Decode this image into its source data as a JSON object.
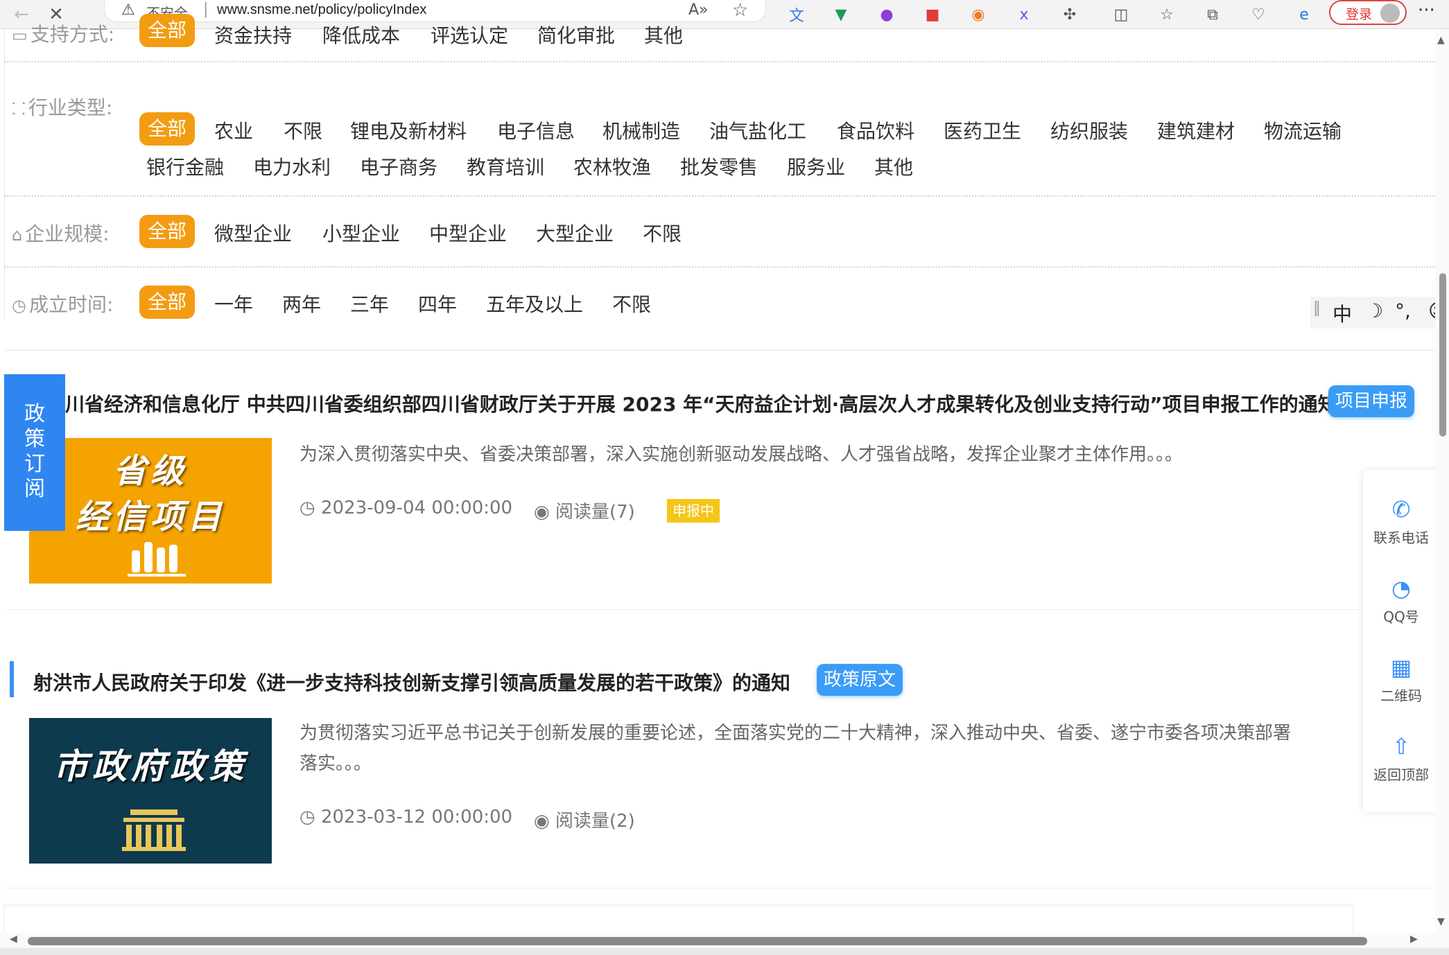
{
  "browser": {
    "back_icon": "back-arrow-icon",
    "close_icon": "close-icon",
    "security_label": "不安全",
    "separator": "|",
    "url": "www.snsme.net/policy/policyIndex",
    "login_label": "登录"
  },
  "filters": {
    "support": {
      "label": "支持方式:",
      "options": [
        "全部",
        "资金扶持",
        "降低成本",
        "评选认定",
        "简化审批",
        "其他"
      ]
    },
    "industry": {
      "label": "行业类型:",
      "options": [
        "全部",
        "农业",
        "不限",
        "锂电及新材料",
        "电子信息",
        "机械制造",
        "油气盐化工",
        "食品饮料",
        "医药卫生",
        "纺织服装",
        "建筑建材",
        "物流运输",
        "银行金融",
        "电力水利",
        "电子商务",
        "教育培训",
        "农林牧渔",
        "批发零售",
        "服务业",
        "其他"
      ]
    },
    "scale": {
      "label": "企业规模:",
      "options": [
        "全部",
        "微型企业",
        "小型企业",
        "中型企业",
        "大型企业",
        "不限"
      ]
    },
    "founded": {
      "label": "成立时间:",
      "options": [
        "全部",
        "一年",
        "两年",
        "三年",
        "四年",
        "五年及以上",
        "不限"
      ]
    }
  },
  "ime": {
    "mode": "中",
    "moon": "☽",
    "punct": "°,",
    "emoji": "☺"
  },
  "subscribe_tab": {
    "label": [
      "政",
      "策",
      "订",
      "阅"
    ]
  },
  "policies": [
    {
      "title": "川省经济和信息化厅 中共四川省委组织部四川省财政厅关于开展 2023 年“天府益企计划·高层次人才成果转化及创业支持行动”项目申报工作的通知",
      "tag": "项目申报",
      "thumb_text": [
        "省级",
        "经信项目"
      ],
      "thumb_color": "#f5a300",
      "description": "为深入贯彻落实中央、省委决策部署，深入实施创新驱动发展战略、人才强省战略，发挥企业聚才主体作用。。。",
      "date": "2023-09-04 00:00:00",
      "views": "阅读量(7)",
      "status": "申报中"
    },
    {
      "title": "射洪市人民政府关于印发《进一步支持科技创新支撑引领高质量发展的若干政策》的通知",
      "tag": "政策原文",
      "thumb_text": [
        "市政府政策"
      ],
      "thumb_color": "#0e3a4e",
      "description_line1": "为贯彻落实习近平总书记关于创新发展的重要论述，全面落实党的二十大精神，深入推动中央、省委、遂宁市委各项决策部署",
      "description_line2": "落实。。。",
      "date": "2023-03-12 00:00:00",
      "views": "阅读量(2)"
    }
  ],
  "contact_panel": {
    "items": [
      "联系电话",
      "QQ号",
      "二维码",
      "返回顶部"
    ]
  }
}
